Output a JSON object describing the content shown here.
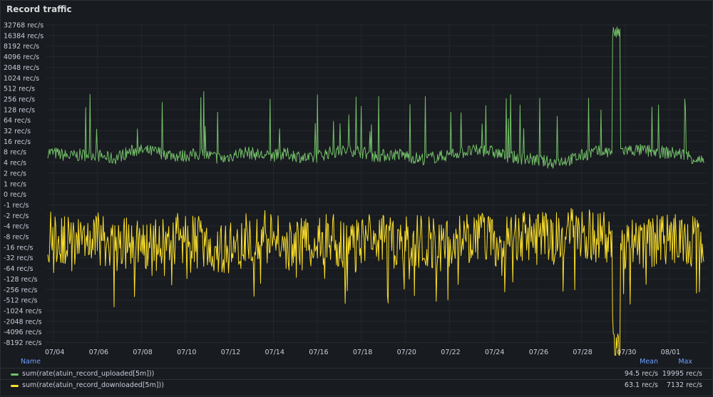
{
  "panel": {
    "title": "Record traffic"
  },
  "chart_data": {
    "type": "line",
    "title": "Record traffic",
    "y_scale": "log2 (symmetric, negative-y for downloads)",
    "y_ticks": [
      "32768 rec/s",
      "16384 rec/s",
      "8192 rec/s",
      "4096 rec/s",
      "2048 rec/s",
      "1024 rec/s",
      "512 rec/s",
      "256 rec/s",
      "128 rec/s",
      "64 rec/s",
      "32 rec/s",
      "16 rec/s",
      "8 rec/s",
      "4 rec/s",
      "2 rec/s",
      "1 rec/s",
      "0 rec/s",
      "-1 rec/s",
      "-2 rec/s",
      "-4 rec/s",
      "-8 rec/s",
      "-16 rec/s",
      "-32 rec/s",
      "-64 rec/s",
      "-128 rec/s",
      "-256 rec/s",
      "-512 rec/s",
      "-1024 rec/s",
      "-2048 rec/s",
      "-4096 rec/s",
      "-8192 rec/s"
    ],
    "x_ticks": [
      "07/04",
      "07/06",
      "07/08",
      "07/10",
      "07/12",
      "07/14",
      "07/16",
      "07/18",
      "07/20",
      "07/22",
      "07/24",
      "07/26",
      "07/28",
      "07/30",
      "08/01"
    ],
    "x_range": [
      "07/03",
      "08/02"
    ],
    "grid": true,
    "legend_placement": "bottom",
    "series": [
      {
        "name": "sum(rate(atuin_record_uploaded[5m]))",
        "color": "#73bf69",
        "mean": "94.5 rec/s",
        "max": "19995 rec/s",
        "x": [
          "07/03",
          "07/04",
          "07/05",
          "07/06",
          "07/07",
          "07/08",
          "07/09",
          "07/10",
          "07/11",
          "07/12",
          "07/13",
          "07/14",
          "07/15",
          "07/16",
          "07/17",
          "07/18",
          "07/19",
          "07/20",
          "07/21",
          "07/22",
          "07/23",
          "07/24",
          "07/25",
          "07/26",
          "07/27",
          "07/28",
          "07/29",
          "07/30",
          "07/31",
          "08/01",
          "08/02"
        ],
        "values": [
          8,
          6,
          7,
          5,
          9,
          8,
          6,
          7,
          5,
          8,
          6,
          7,
          5,
          8,
          9,
          6,
          7,
          5,
          6,
          8,
          9,
          6,
          5,
          4,
          5,
          8,
          19995,
          9,
          8,
          7,
          4
        ]
      },
      {
        "name": "sum(rate(atuin_record_downloaded[5m]))",
        "color": "#fade2a",
        "mean": "63.1 rec/s",
        "max": "7132 rec/s",
        "x": [
          "07/03",
          "07/04",
          "07/05",
          "07/06",
          "07/07",
          "07/08",
          "07/09",
          "07/10",
          "07/11",
          "07/12",
          "07/13",
          "07/14",
          "07/15",
          "07/16",
          "07/17",
          "07/18",
          "07/19",
          "07/20",
          "07/21",
          "07/22",
          "07/23",
          "07/24",
          "07/25",
          "07/26",
          "07/27",
          "07/28",
          "07/29",
          "07/30",
          "07/31",
          "08/01",
          "08/02"
        ],
        "values": [
          -8,
          -12,
          -6,
          -16,
          -10,
          -14,
          -8,
          -12,
          -20,
          -10,
          -8,
          -14,
          -12,
          -10,
          -16,
          -8,
          -12,
          -10,
          -14,
          -8,
          -10,
          -12,
          -8,
          -10,
          -6,
          -8,
          -7132,
          -12,
          -10,
          -8,
          -14
        ]
      }
    ]
  },
  "legend": {
    "header": {
      "name": "Name",
      "mean": "Mean",
      "max": "Max"
    }
  }
}
